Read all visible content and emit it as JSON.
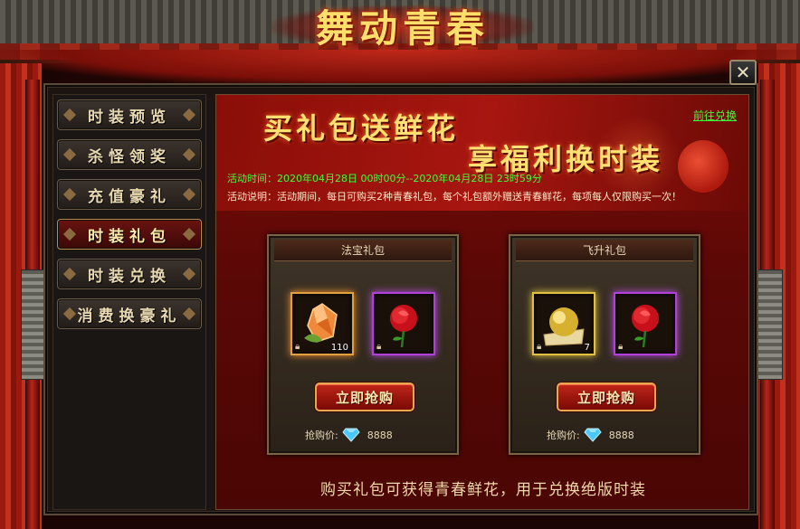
{
  "window": {
    "title": "舞动青春",
    "close_symbol": "✕"
  },
  "sidebar": {
    "items": [
      {
        "label": "时装预览",
        "active": false
      },
      {
        "label": "杀怪领奖",
        "active": false
      },
      {
        "label": "充值豪礼",
        "active": false
      },
      {
        "label": "时装礼包",
        "active": true
      },
      {
        "label": "时装兑换",
        "active": false
      },
      {
        "label": "消费换豪礼",
        "active": false
      }
    ]
  },
  "header": {
    "slogan_1": "买礼包送鲜花",
    "slogan_2": "享福利换时装",
    "exchange_link": "前往兑换",
    "time_label": "活动时间：",
    "time_value": "2020年04月28日 00时00分--2020年04月28日 23时59分",
    "desc_label": "活动说明：",
    "desc_value": "活动期间，每日可购买2种青春礼包，每个礼包额外赠送青春鲜花，每项每人仅限购买一次！"
  },
  "packs": [
    {
      "title": "法宝礼包",
      "items": [
        {
          "icon": "orange-crystal-icon",
          "count": "110"
        },
        {
          "icon": "red-rose-icon",
          "count": ""
        }
      ],
      "buy_label": "立即抢购",
      "price_label": "抢购价:",
      "price_icon": "diamond-icon",
      "price_value": "8888"
    },
    {
      "title": "飞升礼包",
      "items": [
        {
          "icon": "golden-orb-icon",
          "count": "7"
        },
        {
          "icon": "red-rose-icon",
          "count": ""
        }
      ],
      "buy_label": "立即抢购",
      "price_label": "抢购价:",
      "price_icon": "diamond-icon",
      "price_value": "8888"
    }
  ],
  "footer": {
    "note": "购买礼包可获得青春鲜花，用于兑换绝版时装"
  },
  "colors": {
    "accent_gold": "#ffe070",
    "link_green": "#3aff3a",
    "panel_red": "#7a0c08"
  }
}
